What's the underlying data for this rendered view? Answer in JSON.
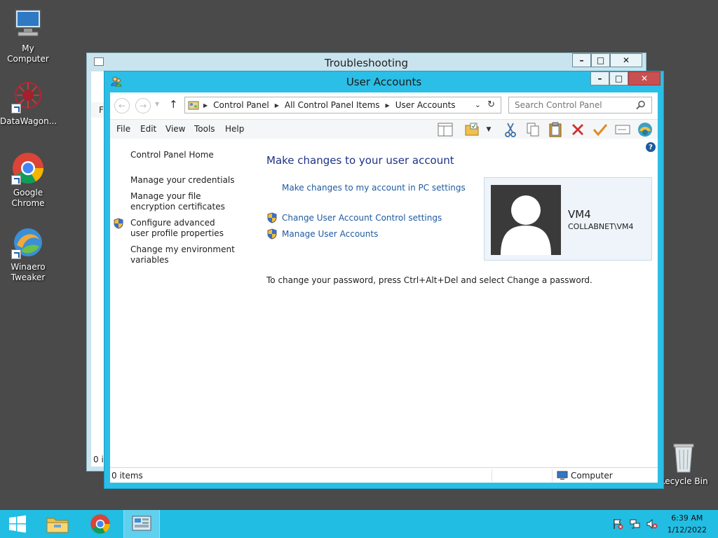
{
  "desktop": {
    "icons": [
      {
        "label": "My Computer"
      },
      {
        "label": "DataWagon..."
      },
      {
        "label": "Google Chrome"
      },
      {
        "label": "Winaero Tweaker"
      },
      {
        "label": "Recycle Bin"
      }
    ]
  },
  "back_window": {
    "title": "Troubleshooting",
    "fragment_menu": "Fi",
    "fragment_status": "0 it"
  },
  "window": {
    "title": "User Accounts",
    "caption": {
      "minimize": "–",
      "maximize": "□",
      "close": "✕"
    },
    "address": {
      "breadcrumbs": [
        "Control Panel",
        "All Control Panel Items",
        "User Accounts"
      ]
    },
    "search": {
      "placeholder": "Search Control Panel"
    },
    "menu": [
      "File",
      "Edit",
      "View",
      "Tools",
      "Help"
    ],
    "left_nav": {
      "home": "Control Panel Home",
      "items": [
        "Manage your credentials",
        "Manage your file encryption certificates",
        "Configure advanced user profile properties",
        "Change my environment variables"
      ]
    },
    "main": {
      "title": "Make changes to your user account",
      "pc_settings_link": "Make changes to my account in PC settings",
      "uac_link": "Change User Account Control settings",
      "manage_link": "Manage User Accounts",
      "password_note": "To change your password, press Ctrl+Alt+Del and select Change a password."
    },
    "user": {
      "name": "VM4",
      "domain": "COLLABNET\\VM4"
    },
    "status": {
      "items": "0 items",
      "location": "Computer"
    }
  },
  "taskbar": {
    "clock": {
      "time": "6:39 AM",
      "date": "1/12/2022"
    }
  },
  "colors": {
    "accent": "#2bbee6",
    "taskbar": "#22bde3",
    "link": "#1e5aa0",
    "title_blue": "#1e3287"
  }
}
